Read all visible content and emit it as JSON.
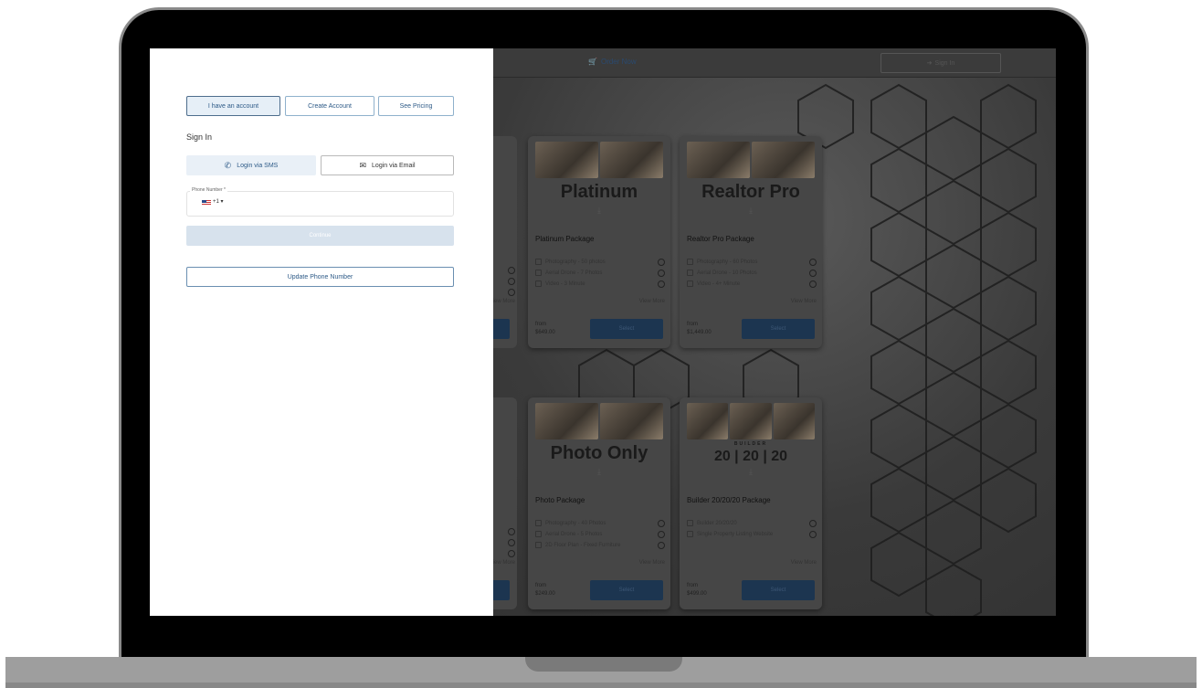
{
  "header": {
    "order_now": "Order Now",
    "sign_in": "Sign In"
  },
  "login": {
    "tabs": [
      "I have an account",
      "Create Account",
      "See Pricing"
    ],
    "heading": "Sign In",
    "sms_label": "Login via SMS",
    "email_label": "Login via Email",
    "phone_label": "Phone Number *",
    "dial_code": "+1",
    "continue_label": "Continue",
    "update_phone_label": "Update Phone Number"
  },
  "cards": [
    {
      "big_name": "Platinum",
      "title": "Platinum Package",
      "features": [
        "Photography - 50 photos",
        "Aerial Drone - 7 Photos",
        "Video - 3 Minute"
      ],
      "view_more": "View More",
      "from_label": "from",
      "price": "$649.00",
      "select_label": "Select"
    },
    {
      "big_name": "Realtor Pro",
      "title": "Realtor Pro Package",
      "features": [
        "Photography - 60 Photos",
        "Aerial Drone - 10 Photos",
        "Video - 4+ Minute"
      ],
      "view_more": "View More",
      "from_label": "from",
      "price": "$1,449.00",
      "select_label": "Select"
    },
    {
      "big_name": "Photo Only",
      "title": "Photo Package",
      "features": [
        "Photography - 40 Photos",
        "Aerial Drone - 5 Photos",
        "2D Floor Plan - Fixed Furniture"
      ],
      "view_more": "View More",
      "from_label": "from",
      "price": "$249.00",
      "select_label": "Select"
    },
    {
      "big_name_small": "BUILDER",
      "big_name": "20 | 20 | 20",
      "title": "Builder 20/20/20 Package",
      "features": [
        "Builder 20/20/20",
        "Single Property Listing Website"
      ],
      "view_more": "View More",
      "from_label": "from",
      "price": "$499.00",
      "select_label": "Select"
    }
  ],
  "partial_view_more": "View More",
  "colors": {
    "accent": "#2d5a87",
    "select_button": "#1c3550",
    "panel_bg": "#ffffff"
  }
}
